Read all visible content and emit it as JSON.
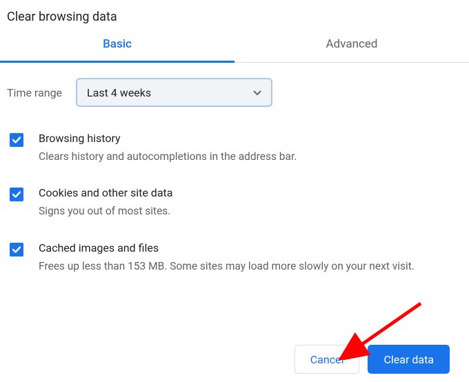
{
  "title": "Clear browsing data",
  "tabs": {
    "basic": "Basic",
    "advanced": "Advanced"
  },
  "timerange": {
    "label": "Time range",
    "selected": "Last 4 weeks"
  },
  "options": [
    {
      "title": "Browsing history",
      "desc": "Clears history and autocompletions in the address bar.",
      "checked": true
    },
    {
      "title": "Cookies and other site data",
      "desc": "Signs you out of most sites.",
      "checked": true
    },
    {
      "title": "Cached images and files",
      "desc": "Frees up less than 153 MB. Some sites may load more slowly on your next visit.",
      "checked": true
    }
  ],
  "buttons": {
    "cancel": "Cancel",
    "clear": "Clear data"
  }
}
